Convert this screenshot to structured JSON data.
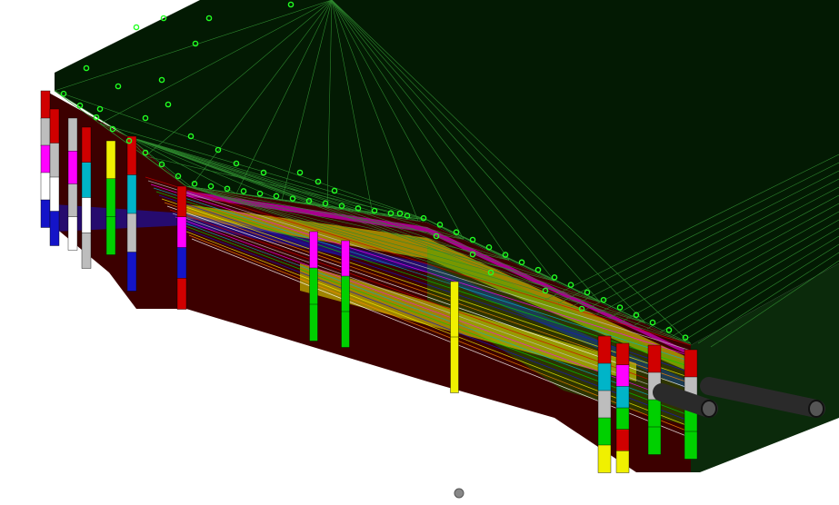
{
  "viewer": {
    "background_color": "#ffffff",
    "top_surface_color": "#031a03",
    "side_wall_color": "#3c0000",
    "mesh_line_color": "#2f8a2f",
    "marker_color": "#22ff22",
    "pipe_color": "#2a2a2a",
    "pivot_marker_color": "#888888",
    "strata_colors": [
      "#d00000",
      "#bdbdbd",
      "#ff00ff",
      "#00b4c8",
      "#00d000",
      "#1414c8",
      "#f0f000",
      "#ff8a00",
      "#ffffff"
    ]
  }
}
